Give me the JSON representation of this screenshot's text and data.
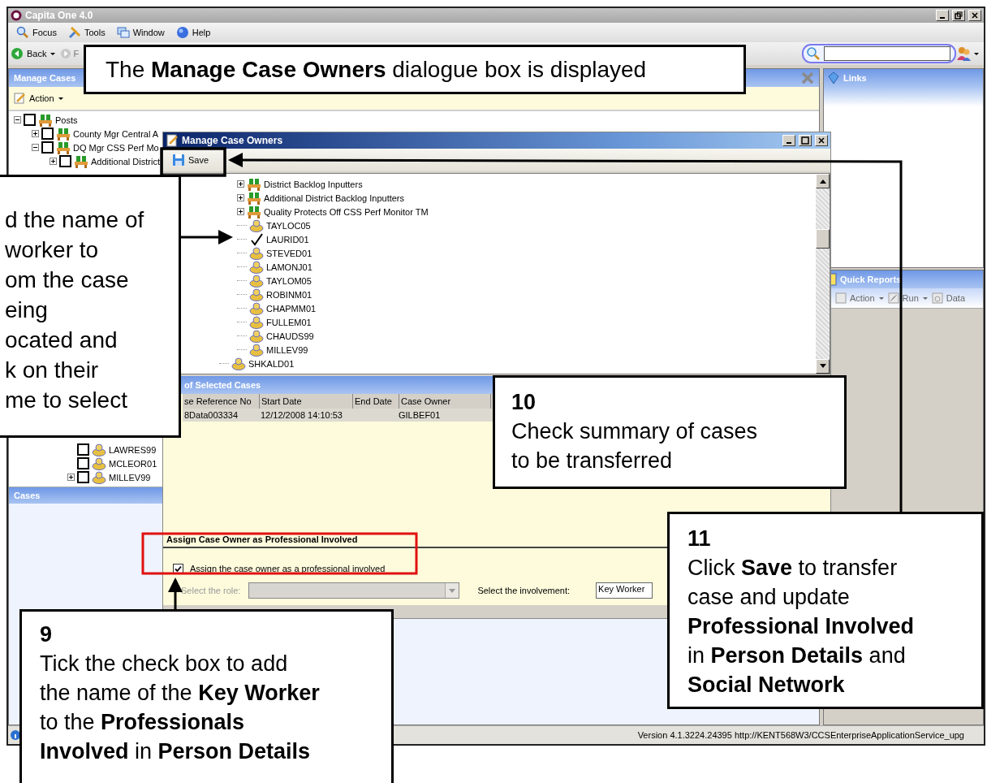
{
  "app": {
    "title": "Capita One 4.0",
    "menu": [
      "Focus",
      "Tools",
      "Window",
      "Help"
    ],
    "toolbar": {
      "back": "Back",
      "forward": "F"
    }
  },
  "manage_cases": {
    "title": "Manage Cases",
    "action": "Action",
    "tree": [
      {
        "label": "Posts",
        "kind": "post",
        "expanded": true,
        "checked": false,
        "children": [
          {
            "label": "County Mgr Central A",
            "kind": "post",
            "expanded": false,
            "checked": false
          },
          {
            "label": "DQ Mgr CSS Perf Mo",
            "kind": "post",
            "expanded": true,
            "checked": false,
            "children": [
              {
                "label": "Additional District",
                "kind": "post",
                "expanded": false,
                "checked": false
              }
            ]
          }
        ]
      }
    ],
    "tree_lower": [
      {
        "label": "LAWRES99",
        "kind": "worker",
        "checked": false
      },
      {
        "label": "MCLEOR01",
        "kind": "worker",
        "checked": false
      },
      {
        "label": "MILLEV99",
        "kind": "worker",
        "expanded": false,
        "checked": false
      }
    ],
    "cases_title": "Cases"
  },
  "links": {
    "title": "Links"
  },
  "quick_reports": {
    "title": "Quick Reports",
    "actions": [
      "Action",
      "Run",
      "Data"
    ]
  },
  "status_bar": {
    "text": "Version 4.1.3224.24395  http://KENT568W3/CCSEnterpriseApplicationService_upg"
  },
  "dialog": {
    "title": "Manage Case Owners",
    "save": "Save",
    "tree": {
      "branch": [
        {
          "label": "District Backlog Inputters",
          "kind": "post",
          "expanded": false,
          "selected": false
        },
        {
          "label": "Additional District Backlog Inputters",
          "kind": "post",
          "expanded": false,
          "selected": false
        },
        {
          "label": "Quality Protects Off CSS Perf Monitor TM",
          "kind": "post",
          "expanded": false,
          "selected": false
        },
        {
          "label": "TAYLOC05",
          "kind": "worker",
          "selected": false
        },
        {
          "label": "LAURID01",
          "kind": "worker",
          "selected": true
        },
        {
          "label": "STEVED01",
          "kind": "worker",
          "selected": false
        },
        {
          "label": "LAMONJ01",
          "kind": "worker",
          "selected": false
        },
        {
          "label": "TAYLOM05",
          "kind": "worker",
          "selected": false
        },
        {
          "label": "ROBINM01",
          "kind": "worker",
          "selected": false
        },
        {
          "label": "CHAPMM01",
          "kind": "worker",
          "selected": false
        },
        {
          "label": "FULLEM01",
          "kind": "worker",
          "selected": false
        },
        {
          "label": "CHAUDS99",
          "kind": "worker",
          "selected": false
        },
        {
          "label": "MILLEV99",
          "kind": "worker",
          "selected": false
        }
      ],
      "after": [
        {
          "label": "SHKALD01",
          "kind": "worker",
          "selected": false
        }
      ]
    },
    "cases_title": "of Selected Cases",
    "table": {
      "columns": [
        "se Reference No",
        "Start Date",
        "End Date",
        "Case Owner"
      ],
      "rows": [
        {
          "case_ref": "8Data003334",
          "start_date": "12/12/2008 14:10:53",
          "case_owner": "GILBEF01"
        }
      ]
    },
    "assign": {
      "heading": "Assign Case Owner as Professional Involved",
      "checkbox": {
        "label": "Assign the case owner as a professional involved",
        "checked": true
      },
      "role": {
        "label": "Select the role:",
        "disabled": true
      },
      "involvement": {
        "label": "Select the involvement:",
        "value": "Key Worker"
      }
    }
  },
  "callouts": [
    {
      "kind": "top",
      "text": "The **Manage Case Owners** dialogue box is displayed"
    },
    {
      "kind": "left",
      "text": "d the name of\nworker to\nom the case\neing\nocated and\nk on their\nme to select"
    },
    {
      "kind": "ten",
      "number": "10",
      "text": "Check summary of cases\nto be transferred"
    },
    {
      "kind": "eleven",
      "number": "11",
      "text": "Click **Save** to transfer\ncase and update\n**Professional Involved**\nin **Person Details** and\n**Social Network**"
    },
    {
      "kind": "nine",
      "number": "9",
      "text": "Tick the check box to add\nthe name of the **Key Worker**\nto the **Professionals\nInvolved** in **Person Details**"
    }
  ]
}
